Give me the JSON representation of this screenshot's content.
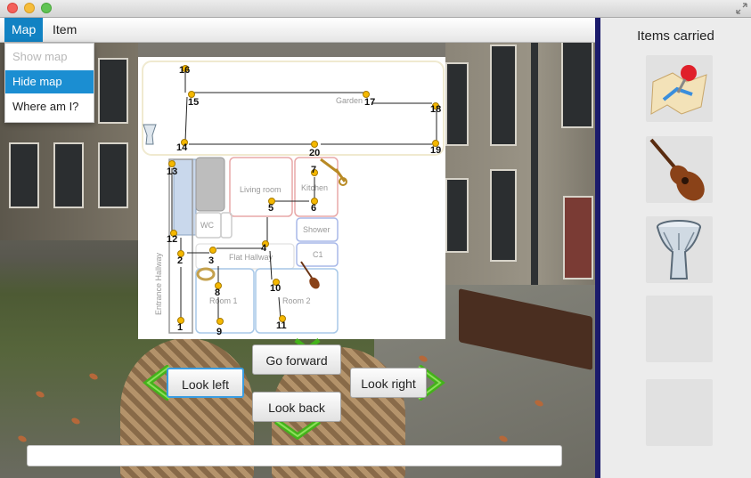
{
  "menubar": {
    "menus": [
      "Map",
      "Item"
    ],
    "map_menu_items": [
      "Show map",
      "Hide map",
      "Where am I?"
    ]
  },
  "map": {
    "rooms": [
      "Garden",
      "Living room",
      "Kitchen",
      "WC",
      "Shower",
      "C1",
      "Flat Hallway",
      "Entrance Hallway",
      "Room 1",
      "Room 2"
    ],
    "node_numbers": [
      "1",
      "2",
      "3",
      "4",
      "5",
      "6",
      "7",
      "8",
      "9",
      "10",
      "11",
      "12",
      "13",
      "14",
      "15",
      "16",
      "17",
      "18",
      "19",
      "20"
    ]
  },
  "navigation": {
    "go_forward": "Go forward",
    "look_left": "Look left",
    "look_right": "Look right",
    "look_back": "Look back"
  },
  "status_text": "",
  "sidebar": {
    "title": "Items carried",
    "slots": [
      {
        "item": "map-icon"
      },
      {
        "item": "guitar-icon"
      },
      {
        "item": "drum-icon"
      },
      {
        "item": "empty"
      },
      {
        "item": "empty"
      }
    ]
  },
  "colors": {
    "menu_active": "#1182c3",
    "arrow_green": "#44b21b",
    "node_marker": "#f5b800",
    "divider": "#1b1b6b"
  }
}
